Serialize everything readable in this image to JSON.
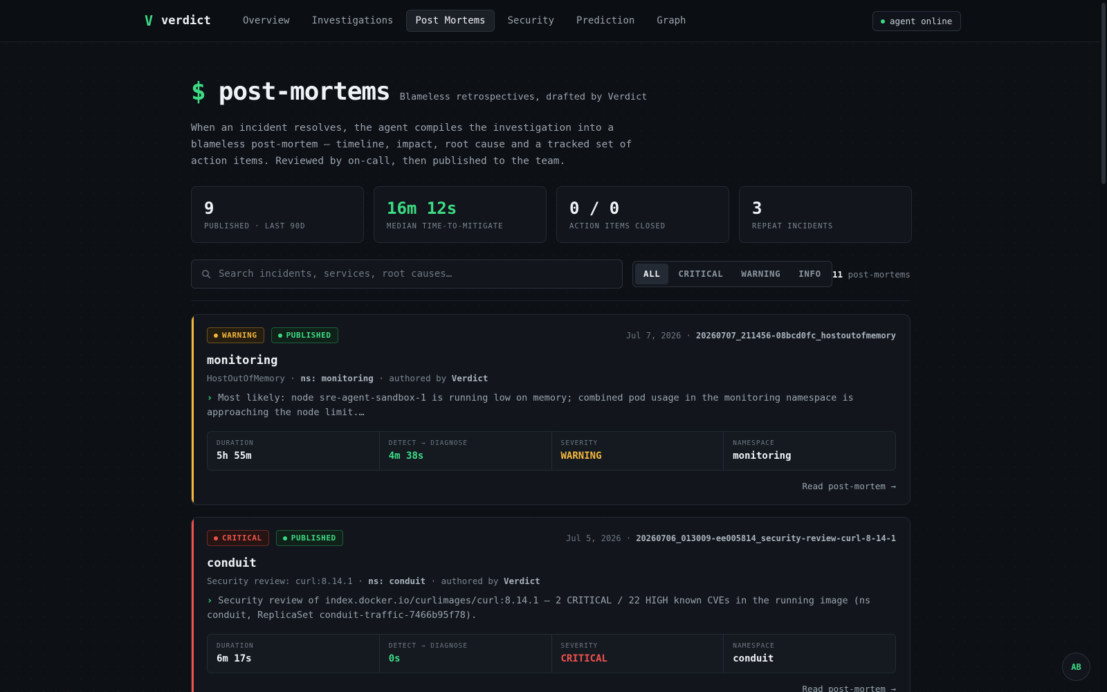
{
  "app": {
    "logo_glyph": "V",
    "name": "verdict",
    "agent_status": "agent online"
  },
  "nav": {
    "items": [
      {
        "label": "Overview"
      },
      {
        "label": "Investigations"
      },
      {
        "label": "Post Mortems",
        "active": true
      },
      {
        "label": "Security"
      },
      {
        "label": "Prediction"
      },
      {
        "label": "Graph"
      }
    ]
  },
  "header": {
    "prompt": "$",
    "title": "post-mortems",
    "subtitle": "Blameless retrospectives, drafted by Verdict",
    "intro": "When an incident resolves, the agent compiles the investigation into a blameless post-mortem — timeline, impact, root cause and a tracked set of action items. Reviewed by on-call, then published to the team."
  },
  "stats": [
    {
      "value": "9",
      "label": "PUBLISHED · LAST 90D"
    },
    {
      "value": "16m 12s",
      "label": "MEDIAN TIME-TO-MITIGATE",
      "accent": "#3ddc84"
    },
    {
      "value": "0 / 0",
      "label": "ACTION ITEMS CLOSED"
    },
    {
      "value": "3",
      "label": "REPEAT INCIDENTS"
    }
  ],
  "search": {
    "placeholder": "Search incidents, services, root causes…"
  },
  "filters": {
    "options": [
      "ALL",
      "CRITICAL",
      "WARNING",
      "INFO"
    ],
    "selected": "ALL"
  },
  "count": {
    "value": "11",
    "label": "post-mortems"
  },
  "cards": [
    {
      "severity": "WARNING",
      "status": "PUBLISHED",
      "date": "Jul 7, 2026",
      "id": "20260707_211456-08bcd0fc_hostoutofmemory",
      "title": "monitoring",
      "alert": "HostOutOfMemory",
      "ns_label": "ns: monitoring",
      "authored_prefix": "authored by",
      "author": "Verdict",
      "summary": "Most likely: node sre-agent-sandbox-1 is running low on memory; combined pod usage in the monitoring namespace is approaching the node limit.…",
      "metrics": [
        {
          "label": "DURATION",
          "value": "5h 55m"
        },
        {
          "label": "DETECT → DIAGNOSE",
          "value": "4m 38s"
        },
        {
          "label": "SEVERITY",
          "value": "WARNING"
        },
        {
          "label": "NAMESPACE",
          "value": "monitoring"
        }
      ],
      "link": "Read post-mortem →"
    },
    {
      "severity": "CRITICAL",
      "status": "PUBLISHED",
      "date": "Jul 5, 2026",
      "id": "20260706_013009-ee005814_security-review-curl-8-14-1",
      "title": "conduit",
      "alert": "Security review: curl:8.14.1",
      "ns_label": "ns: conduit",
      "authored_prefix": "authored by",
      "author": "Verdict",
      "summary": "Security review of index.docker.io/curlimages/curl:8.14.1 — 2 CRITICAL / 22 HIGH known CVEs in the running image (ns conduit, ReplicaSet conduit-traffic-7466b95f78).",
      "metrics": [
        {
          "label": "DURATION",
          "value": "6m 17s"
        },
        {
          "label": "DETECT → DIAGNOSE",
          "value": "0s"
        },
        {
          "label": "SEVERITY",
          "value": "CRITICAL"
        },
        {
          "label": "NAMESPACE",
          "value": "conduit"
        }
      ],
      "link": "Read post-mortem →"
    }
  ],
  "user": {
    "initials": "AB"
  },
  "colors": {
    "accent_green": "#3ddc84",
    "warning": "#f5b83d",
    "critical": "#f0524c",
    "background": "#0d1015"
  }
}
